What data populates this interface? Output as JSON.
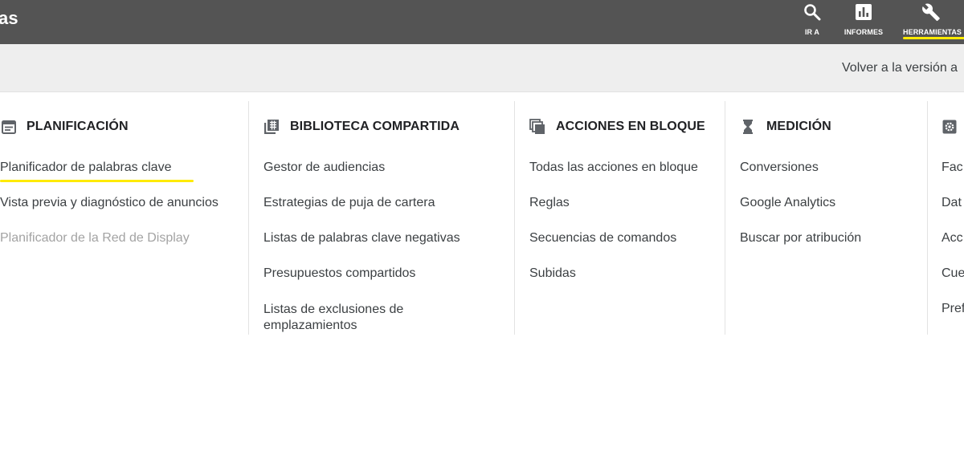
{
  "app": {
    "title_fragment": "as"
  },
  "topnav": {
    "items": [
      {
        "label": "IR A",
        "icon": "search-icon"
      },
      {
        "label": "INFORMES",
        "icon": "reports-icon"
      },
      {
        "label": "HERRAMIENTAS",
        "icon": "wrench-icon",
        "active": true
      }
    ]
  },
  "subheader": {
    "back_link": "Volver a la versión a"
  },
  "columns": [
    {
      "title": "PLANIFICACIÓN",
      "icon": "calendar-icon",
      "items": [
        {
          "label": "Planificador de palabras clave",
          "highlighted": true
        },
        {
          "label": "Vista previa y diagnóstico de anuncios"
        },
        {
          "label": "Planificador de la Red de Display",
          "disabled": true
        }
      ]
    },
    {
      "title": "BIBLIOTECA COMPARTIDA",
      "icon": "library-icon",
      "items": [
        {
          "label": "Gestor de audiencias"
        },
        {
          "label": "Estrategias de puja de cartera"
        },
        {
          "label": "Listas de palabras clave negativas"
        },
        {
          "label": "Presupuestos compartidos"
        },
        {
          "label": "Listas de exclusiones de emplazamientos"
        }
      ]
    },
    {
      "title": "ACCIONES EN BLOQUE",
      "icon": "bulk-actions-icon",
      "items": [
        {
          "label": "Todas las acciones en bloque"
        },
        {
          "label": "Reglas"
        },
        {
          "label": "Secuencias de comandos"
        },
        {
          "label": "Subidas"
        }
      ]
    },
    {
      "title": "MEDICIÓN",
      "icon": "hourglass-icon",
      "items": [
        {
          "label": "Conversiones"
        },
        {
          "label": "Google Analytics"
        },
        {
          "label": "Buscar por atribución"
        }
      ]
    },
    {
      "title": "",
      "icon": "settings-icon",
      "items": [
        {
          "label": "Fac"
        },
        {
          "label": "Dat"
        },
        {
          "label": "Acc"
        },
        {
          "label": "Cue"
        },
        {
          "label": "Pref"
        }
      ]
    }
  ],
  "colors": {
    "topbar_bg": "#545454",
    "highlight": "#ffeb00",
    "strip_bg": "#eeeeee",
    "disabled_text": "#a3a3a3"
  }
}
